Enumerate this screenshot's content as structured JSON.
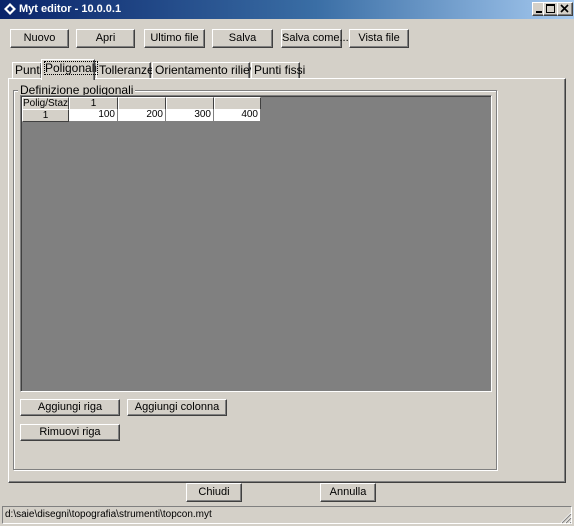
{
  "window": {
    "title": "Myt editor - 10.0.0.1"
  },
  "caption_buttons": {
    "minimize": "_",
    "maximize": "□",
    "close": "×"
  },
  "toolbar": {
    "nuovo": "Nuovo",
    "apri": "Apri",
    "ultimo_file": "Ultimo file",
    "salva": "Salva",
    "salva_come": "Salva come...",
    "vista_file": "Vista file"
  },
  "tabs": [
    "Punti",
    "Poligonali",
    "Tolleranze",
    "Orientamento rilievo",
    "Punti fissi"
  ],
  "active_tab": "Poligonali",
  "group": {
    "title": "Definizione poligonali",
    "grid": {
      "corner": "Polig/Staz",
      "columns": [
        "1",
        "",
        "",
        ""
      ],
      "rows": [
        {
          "header": "1",
          "values": [
            "100",
            "200",
            "300",
            "400"
          ]
        }
      ]
    },
    "buttons": {
      "aggiungi_riga": "Aggiungi riga",
      "aggiungi_colonna": "Aggiungi colonna",
      "rimuovi_riga": "Rimuovi riga"
    }
  },
  "footer": {
    "chiudi": "Chiudi",
    "annulla": "Annulla"
  },
  "status": {
    "path": "d:\\saie\\disegni\\topografia\\strumenti\\topcon.myt"
  }
}
